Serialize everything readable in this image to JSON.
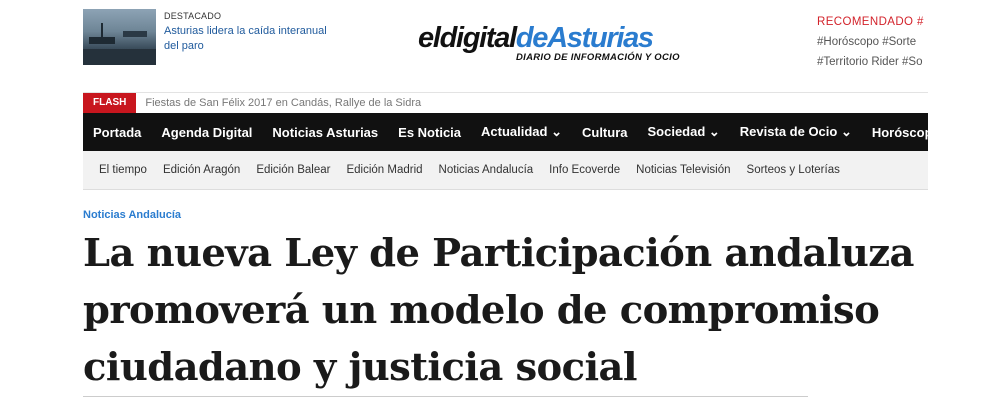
{
  "featured": {
    "label": "DESTACADO",
    "title": "Asturias lidera la caída interanual del paro",
    "thumb_icon": "harbor-photo"
  },
  "logo": {
    "part1": "eldigital",
    "part2": "deAsturias",
    "tagline": "DIARIO DE INFORMACIÓN Y OCIO",
    "color_part1": "#111111",
    "color_part2": "#2a7ccf"
  },
  "recommended": {
    "title": "RECOMENDADO  #",
    "tags_row1": "#Horóscopo  #Sorte",
    "tags_row2": "#Territorio Rider  #So"
  },
  "flash": {
    "badge": "FLASH",
    "text": "Fiestas de San Félix 2017 en Candás, Rallye de la Sidra"
  },
  "main_nav": [
    {
      "label": "Portada"
    },
    {
      "label": "Agenda Digital"
    },
    {
      "label": "Noticias Asturias"
    },
    {
      "label": "Es Noticia"
    },
    {
      "label": "Actualidad ⌄"
    },
    {
      "label": "Cultura"
    },
    {
      "label": "Sociedad ⌄"
    },
    {
      "label": "Revista de Ocio ⌄"
    },
    {
      "label": "Horóscop"
    }
  ],
  "sub_nav": [
    {
      "label": "El tiempo"
    },
    {
      "label": "Edición Aragón"
    },
    {
      "label": "Edición Balear"
    },
    {
      "label": "Edición Madrid"
    },
    {
      "label": "Noticias Andalucía"
    },
    {
      "label": "Info Ecoverde"
    },
    {
      "label": "Noticias Televisión"
    },
    {
      "label": "Sorteos y Loterías"
    }
  ],
  "article": {
    "category": "Noticias Andalucía",
    "headline_line1": "La nueva Ley de Participación andaluza",
    "headline_line2": "promoverá un modelo de compromiso",
    "headline_line3": "ciudadano y justicia social"
  },
  "colors": {
    "flash_red": "#c8161e",
    "recommended_red": "#d3232b",
    "link_blue": "#1f5a9c",
    "nav_black": "#111111"
  }
}
